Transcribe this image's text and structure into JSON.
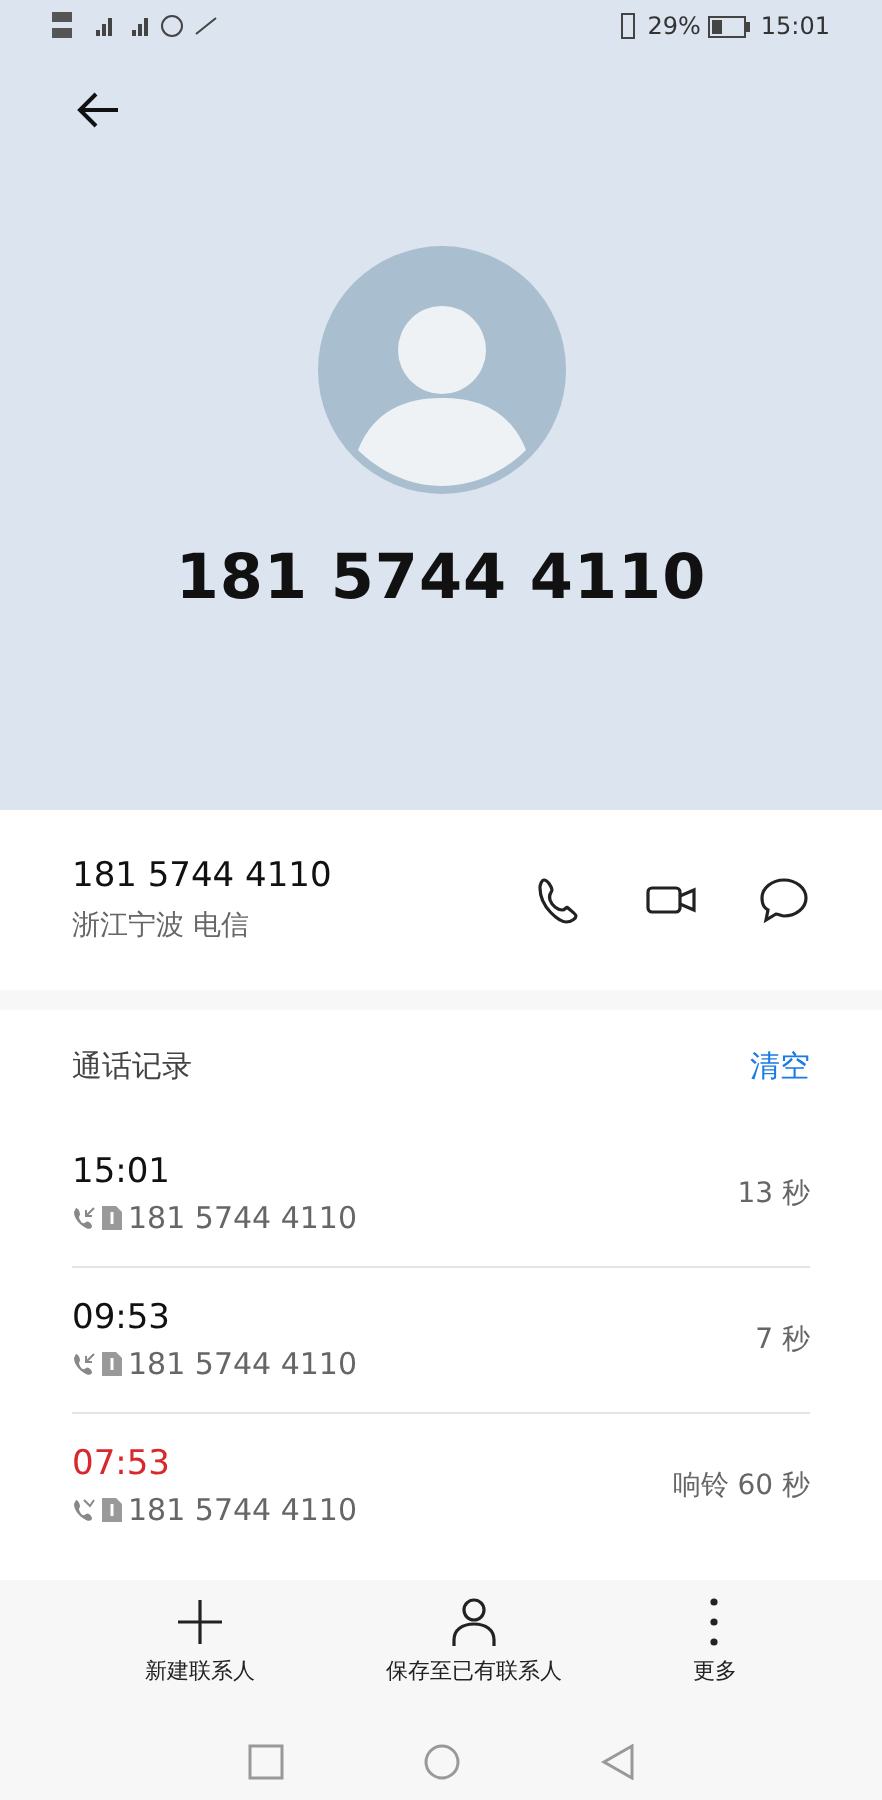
{
  "status_bar": {
    "battery_percent": "29%",
    "time": "15:01"
  },
  "contact": {
    "name": "181 5744 4110"
  },
  "number_card": {
    "number": "181 5744 4110",
    "location": "浙江宁波 电信"
  },
  "call_log": {
    "title": "通话记录",
    "clear_action": "清空",
    "calls": [
      {
        "time": "15:01",
        "number": "181 5744 4110",
        "duration": "13 秒",
        "missed": false
      },
      {
        "time": "09:53",
        "number": "181 5744 4110",
        "duration": "7 秒",
        "missed": false
      },
      {
        "time": "07:53",
        "number": "181 5744 4110",
        "duration": "响铃 60 秒",
        "missed": true
      }
    ]
  },
  "bottom_actions": [
    {
      "kind": "add",
      "label": "新建联系人"
    },
    {
      "kind": "person",
      "label": "保存至已有联系人"
    },
    {
      "kind": "more",
      "label": "更多"
    }
  ]
}
